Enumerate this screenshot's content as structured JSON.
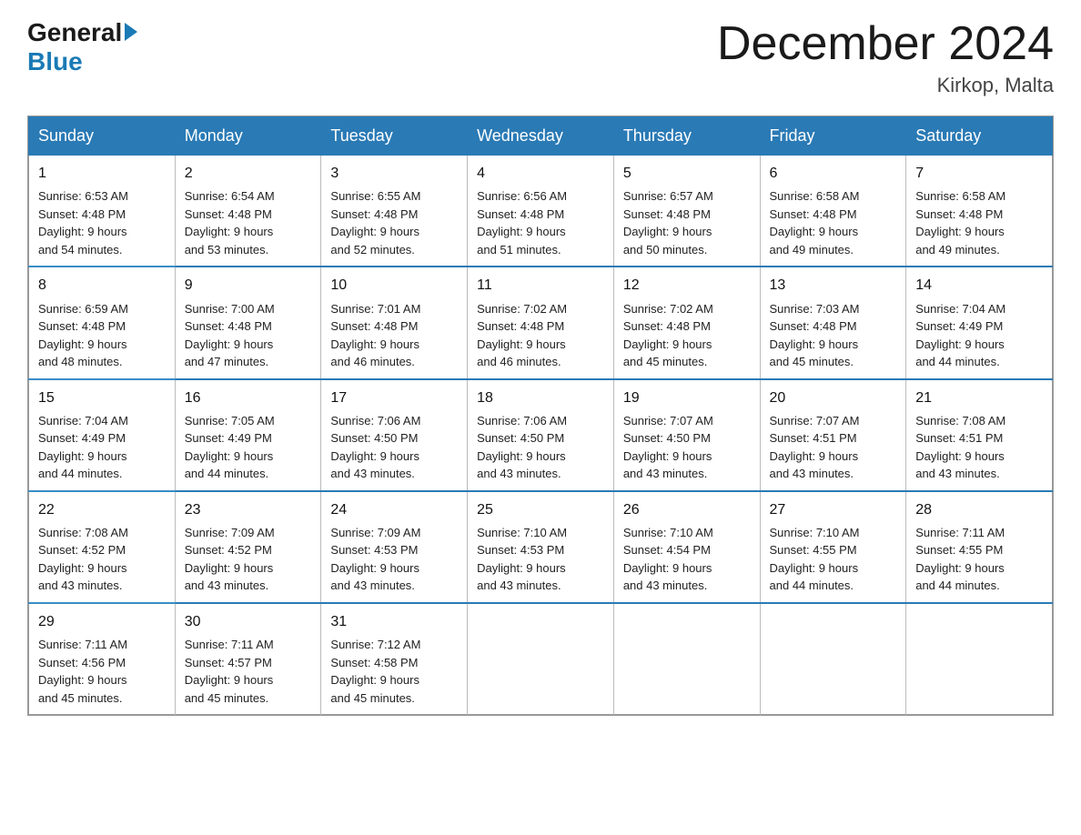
{
  "header": {
    "logo_general": "General",
    "logo_blue": "Blue",
    "title": "December 2024",
    "location": "Kirkop, Malta"
  },
  "days_of_week": [
    "Sunday",
    "Monday",
    "Tuesday",
    "Wednesday",
    "Thursday",
    "Friday",
    "Saturday"
  ],
  "weeks": [
    {
      "days": [
        {
          "num": "1",
          "sunrise": "6:53 AM",
          "sunset": "4:48 PM",
          "daylight": "9 hours and 54 minutes."
        },
        {
          "num": "2",
          "sunrise": "6:54 AM",
          "sunset": "4:48 PM",
          "daylight": "9 hours and 53 minutes."
        },
        {
          "num": "3",
          "sunrise": "6:55 AM",
          "sunset": "4:48 PM",
          "daylight": "9 hours and 52 minutes."
        },
        {
          "num": "4",
          "sunrise": "6:56 AM",
          "sunset": "4:48 PM",
          "daylight": "9 hours and 51 minutes."
        },
        {
          "num": "5",
          "sunrise": "6:57 AM",
          "sunset": "4:48 PM",
          "daylight": "9 hours and 50 minutes."
        },
        {
          "num": "6",
          "sunrise": "6:58 AM",
          "sunset": "4:48 PM",
          "daylight": "9 hours and 49 minutes."
        },
        {
          "num": "7",
          "sunrise": "6:58 AM",
          "sunset": "4:48 PM",
          "daylight": "9 hours and 49 minutes."
        }
      ]
    },
    {
      "days": [
        {
          "num": "8",
          "sunrise": "6:59 AM",
          "sunset": "4:48 PM",
          "daylight": "9 hours and 48 minutes."
        },
        {
          "num": "9",
          "sunrise": "7:00 AM",
          "sunset": "4:48 PM",
          "daylight": "9 hours and 47 minutes."
        },
        {
          "num": "10",
          "sunrise": "7:01 AM",
          "sunset": "4:48 PM",
          "daylight": "9 hours and 46 minutes."
        },
        {
          "num": "11",
          "sunrise": "7:02 AM",
          "sunset": "4:48 PM",
          "daylight": "9 hours and 46 minutes."
        },
        {
          "num": "12",
          "sunrise": "7:02 AM",
          "sunset": "4:48 PM",
          "daylight": "9 hours and 45 minutes."
        },
        {
          "num": "13",
          "sunrise": "7:03 AM",
          "sunset": "4:48 PM",
          "daylight": "9 hours and 45 minutes."
        },
        {
          "num": "14",
          "sunrise": "7:04 AM",
          "sunset": "4:49 PM",
          "daylight": "9 hours and 44 minutes."
        }
      ]
    },
    {
      "days": [
        {
          "num": "15",
          "sunrise": "7:04 AM",
          "sunset": "4:49 PM",
          "daylight": "9 hours and 44 minutes."
        },
        {
          "num": "16",
          "sunrise": "7:05 AM",
          "sunset": "4:49 PM",
          "daylight": "9 hours and 44 minutes."
        },
        {
          "num": "17",
          "sunrise": "7:06 AM",
          "sunset": "4:50 PM",
          "daylight": "9 hours and 43 minutes."
        },
        {
          "num": "18",
          "sunrise": "7:06 AM",
          "sunset": "4:50 PM",
          "daylight": "9 hours and 43 minutes."
        },
        {
          "num": "19",
          "sunrise": "7:07 AM",
          "sunset": "4:50 PM",
          "daylight": "9 hours and 43 minutes."
        },
        {
          "num": "20",
          "sunrise": "7:07 AM",
          "sunset": "4:51 PM",
          "daylight": "9 hours and 43 minutes."
        },
        {
          "num": "21",
          "sunrise": "7:08 AM",
          "sunset": "4:51 PM",
          "daylight": "9 hours and 43 minutes."
        }
      ]
    },
    {
      "days": [
        {
          "num": "22",
          "sunrise": "7:08 AM",
          "sunset": "4:52 PM",
          "daylight": "9 hours and 43 minutes."
        },
        {
          "num": "23",
          "sunrise": "7:09 AM",
          "sunset": "4:52 PM",
          "daylight": "9 hours and 43 minutes."
        },
        {
          "num": "24",
          "sunrise": "7:09 AM",
          "sunset": "4:53 PM",
          "daylight": "9 hours and 43 minutes."
        },
        {
          "num": "25",
          "sunrise": "7:10 AM",
          "sunset": "4:53 PM",
          "daylight": "9 hours and 43 minutes."
        },
        {
          "num": "26",
          "sunrise": "7:10 AM",
          "sunset": "4:54 PM",
          "daylight": "9 hours and 43 minutes."
        },
        {
          "num": "27",
          "sunrise": "7:10 AM",
          "sunset": "4:55 PM",
          "daylight": "9 hours and 44 minutes."
        },
        {
          "num": "28",
          "sunrise": "7:11 AM",
          "sunset": "4:55 PM",
          "daylight": "9 hours and 44 minutes."
        }
      ]
    },
    {
      "days": [
        {
          "num": "29",
          "sunrise": "7:11 AM",
          "sunset": "4:56 PM",
          "daylight": "9 hours and 45 minutes."
        },
        {
          "num": "30",
          "sunrise": "7:11 AM",
          "sunset": "4:57 PM",
          "daylight": "9 hours and 45 minutes."
        },
        {
          "num": "31",
          "sunrise": "7:12 AM",
          "sunset": "4:58 PM",
          "daylight": "9 hours and 45 minutes."
        },
        null,
        null,
        null,
        null
      ]
    }
  ],
  "labels": {
    "sunrise_prefix": "Sunrise: ",
    "sunset_prefix": "Sunset: ",
    "daylight_prefix": "Daylight: "
  }
}
